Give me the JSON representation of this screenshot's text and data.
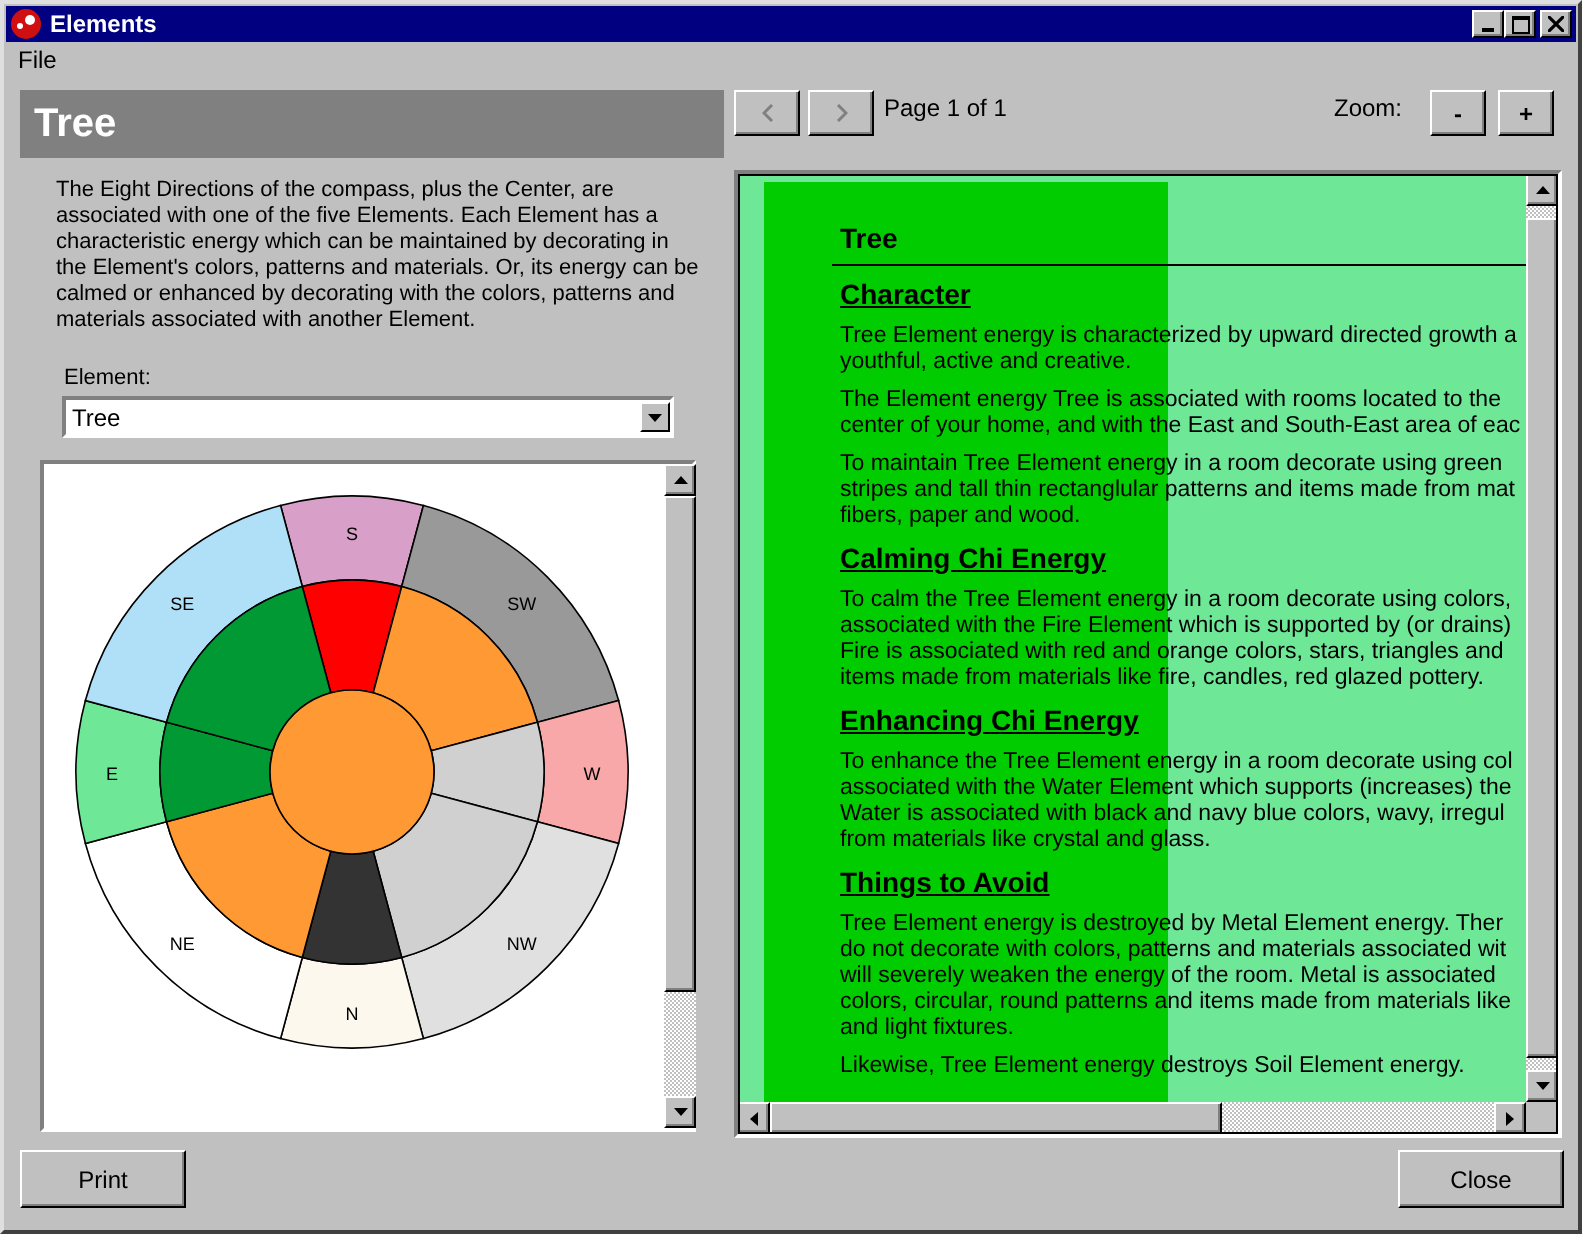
{
  "window": {
    "title": "Elements"
  },
  "menu": [
    {
      "label": "File"
    }
  ],
  "left_panel": {
    "heading": "Tree",
    "description": "The Eight Directions of the compass, plus the Center, are associated with one of the five Elements.  Each Element has a characteristic energy which can be maintained by decorating in the Element's colors, patterns and materials.  Or, its energy can be calmed or enhanced by decorating with the colors, patterns and materials associated with another Element.",
    "element_field": {
      "label": "Element:",
      "value": "Tree"
    },
    "wheel": {
      "center": {
        "color": "#ff9933"
      },
      "sectors": [
        {
          "label": "S",
          "color": "#d8a0c8",
          "inner": {
            "color": "#ff0000"
          }
        },
        {
          "label": "SW",
          "color": "#999999",
          "inner": {
            "color": "#ff9933"
          }
        },
        {
          "label": "W",
          "color": "#f8a8a8",
          "inner": {
            "color": "#d0d0d0"
          }
        },
        {
          "label": "NW",
          "color": "#e0e0e0",
          "inner": {
            "color": "#d0d0d0"
          }
        },
        {
          "label": "N",
          "color": "#fcf8ee",
          "inner": {
            "color": "#333333"
          }
        },
        {
          "label": "NE",
          "color": "#ffffff",
          "inner": {
            "color": "#ff9933"
          }
        },
        {
          "label": "E",
          "color": "#6ee896",
          "inner": {
            "color": "#009933"
          }
        },
        {
          "label": "SE",
          "color": "#b0e0f8",
          "inner": {
            "color": "#009933"
          }
        }
      ]
    }
  },
  "viewer_toolbar": {
    "page_indicator": "Page 1 of 1",
    "zoom_label": "Zoom:",
    "zoom_out": "-",
    "zoom_in": "+"
  },
  "document": {
    "title": "Tree",
    "sections": [
      {
        "heading": "Character",
        "paragraphs": [
          [
            "Tree Element energy is characterized by upward directed growth a",
            "youthful, active and creative."
          ],
          [
            "The Element energy Tree is associated with rooms located to the",
            "center of your home, and with the East and South-East area of eac"
          ],
          [
            "To maintain Tree Element energy in a room decorate using green",
            "stripes and tall thin rectanglular patterns and items made from mat",
            "fibers, paper and wood."
          ]
        ]
      },
      {
        "heading": "Calming Chi Energy",
        "paragraphs": [
          [
            "To calm the Tree Element energy in a room decorate using colors,",
            "associated with the Fire Element which is supported by (or drains)",
            "Fire is associated with red and orange colors, stars, triangles and",
            "items made from materials like fire, candles, red glazed pottery."
          ]
        ]
      },
      {
        "heading": "Enhancing Chi Energy",
        "paragraphs": [
          [
            "To enhance the Tree Element energy in a room decorate using col",
            "associated with the Water Element which supports (increases) the",
            "Water is associated with black and navy blue colors, wavy, irregul",
            "from materials like crystal and glass."
          ]
        ]
      },
      {
        "heading": "Things to Avoid",
        "paragraphs": [
          [
            "Tree Element energy is destroyed by Metal Element energy.  Ther",
            "do not  decorate with colors, patterns and materials associated wit",
            "will severely weaken the energy of the room.  Metal is associated",
            "colors, circular, round patterns and items made from materials like",
            "and light fixtures."
          ],
          [
            "Likewise, Tree Element energy destroys Soil Element energy."
          ]
        ]
      }
    ]
  },
  "buttons": {
    "print": "Print",
    "close": "Close"
  }
}
